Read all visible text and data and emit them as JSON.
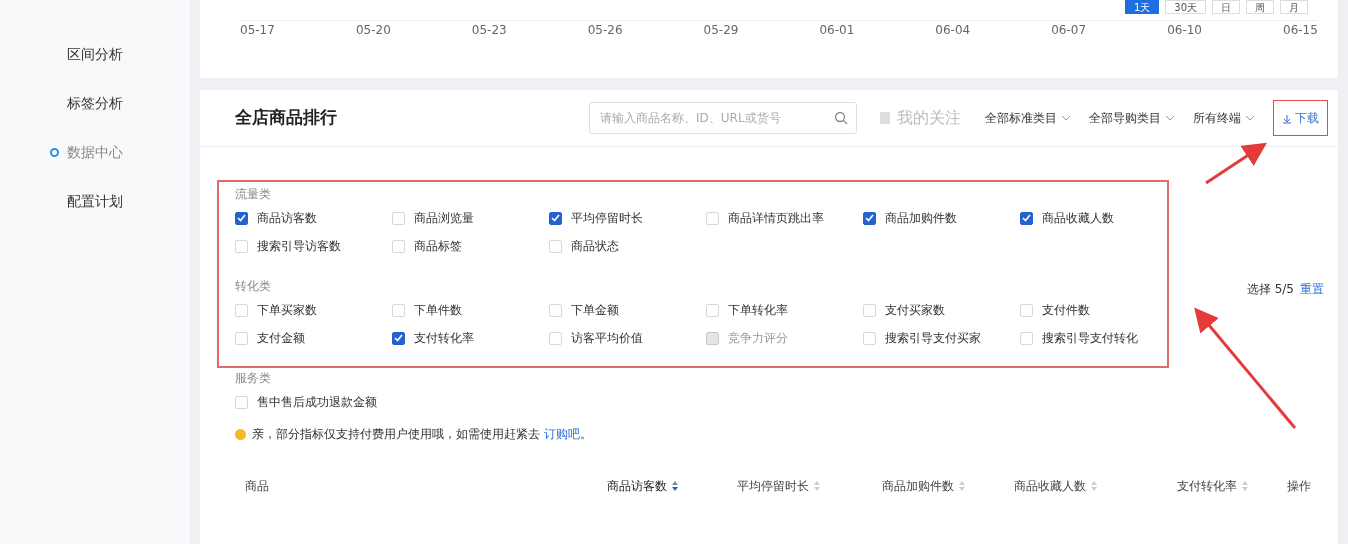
{
  "sidebar": {
    "items": [
      {
        "label": "区间分析",
        "selected": false
      },
      {
        "label": "标签分析",
        "selected": false
      },
      {
        "label": "数据中心",
        "selected": true
      },
      {
        "label": "配置计划",
        "selected": false
      }
    ]
  },
  "trend_chart": {
    "range_buttons": [
      {
        "label": "1天",
        "selected": true
      },
      {
        "label": "30天",
        "selected": false
      },
      {
        "label": "日",
        "selected": false
      },
      {
        "label": "周",
        "selected": false
      },
      {
        "label": "月",
        "selected": false
      }
    ],
    "x_labels": [
      "05-17",
      "05-20",
      "05-23",
      "05-26",
      "05-29",
      "06-01",
      "06-04",
      "06-07",
      "06-10",
      "06-15"
    ]
  },
  "ranking": {
    "title": "全店商品排行",
    "search": {
      "placeholder": "请输入商品名称、ID、URL或货号"
    },
    "follow_filter": "我的关注",
    "dropdowns": [
      "全部标准类目",
      "全部导购类目",
      "所有终端"
    ],
    "download": "下载",
    "selection_count": "选择 5/5",
    "reset": "重置",
    "metric_groups": [
      {
        "title": "流量类",
        "items": [
          {
            "label": "商品访客数",
            "checked": true,
            "disabled": false
          },
          {
            "label": "商品浏览量",
            "checked": false,
            "disabled": false
          },
          {
            "label": "平均停留时长",
            "checked": true,
            "disabled": false
          },
          {
            "label": "商品详情页跳出率",
            "checked": false,
            "disabled": false
          },
          {
            "label": "商品加购件数",
            "checked": true,
            "disabled": false
          },
          {
            "label": "商品收藏人数",
            "checked": true,
            "disabled": false
          },
          {
            "label": "搜索引导访客数",
            "checked": false,
            "disabled": false
          },
          {
            "label": "商品标签",
            "checked": false,
            "disabled": false
          },
          {
            "label": "商品状态",
            "checked": false,
            "disabled": false
          }
        ]
      },
      {
        "title": "转化类",
        "items": [
          {
            "label": "下单买家数",
            "checked": false,
            "disabled": false
          },
          {
            "label": "下单件数",
            "checked": false,
            "disabled": false
          },
          {
            "label": "下单金额",
            "checked": false,
            "disabled": false
          },
          {
            "label": "下单转化率",
            "checked": false,
            "disabled": false
          },
          {
            "label": "支付买家数",
            "checked": false,
            "disabled": false
          },
          {
            "label": "支付件数",
            "checked": false,
            "disabled": false
          },
          {
            "label": "支付金额",
            "checked": false,
            "disabled": false
          },
          {
            "label": "支付转化率",
            "checked": true,
            "disabled": false
          },
          {
            "label": "访客平均价值",
            "checked": false,
            "disabled": false
          },
          {
            "label": "竞争力评分",
            "checked": false,
            "disabled": true
          },
          {
            "label": "搜索引导支付买家",
            "checked": false,
            "disabled": false
          },
          {
            "label": "搜索引导支付转化",
            "checked": false,
            "disabled": false
          }
        ]
      },
      {
        "title": "服务类",
        "items": [
          {
            "label": "售中售后成功退款金额",
            "checked": false,
            "disabled": false
          }
        ]
      }
    ],
    "notice": {
      "text": "亲，部分指标仅支持付费用户使用哦，如需使用赶紧去",
      "link": "订购吧",
      "end": "。"
    },
    "columns": [
      {
        "label": "商品"
      },
      {
        "label": "商品访客数",
        "sorted": true
      },
      {
        "label": "平均停留时长",
        "sorted": false
      },
      {
        "label": "商品加购件数",
        "sorted": false
      },
      {
        "label": "商品收藏人数",
        "sorted": false
      },
      {
        "label": "支付转化率",
        "sorted": false
      },
      {
        "label": "操作"
      }
    ]
  }
}
